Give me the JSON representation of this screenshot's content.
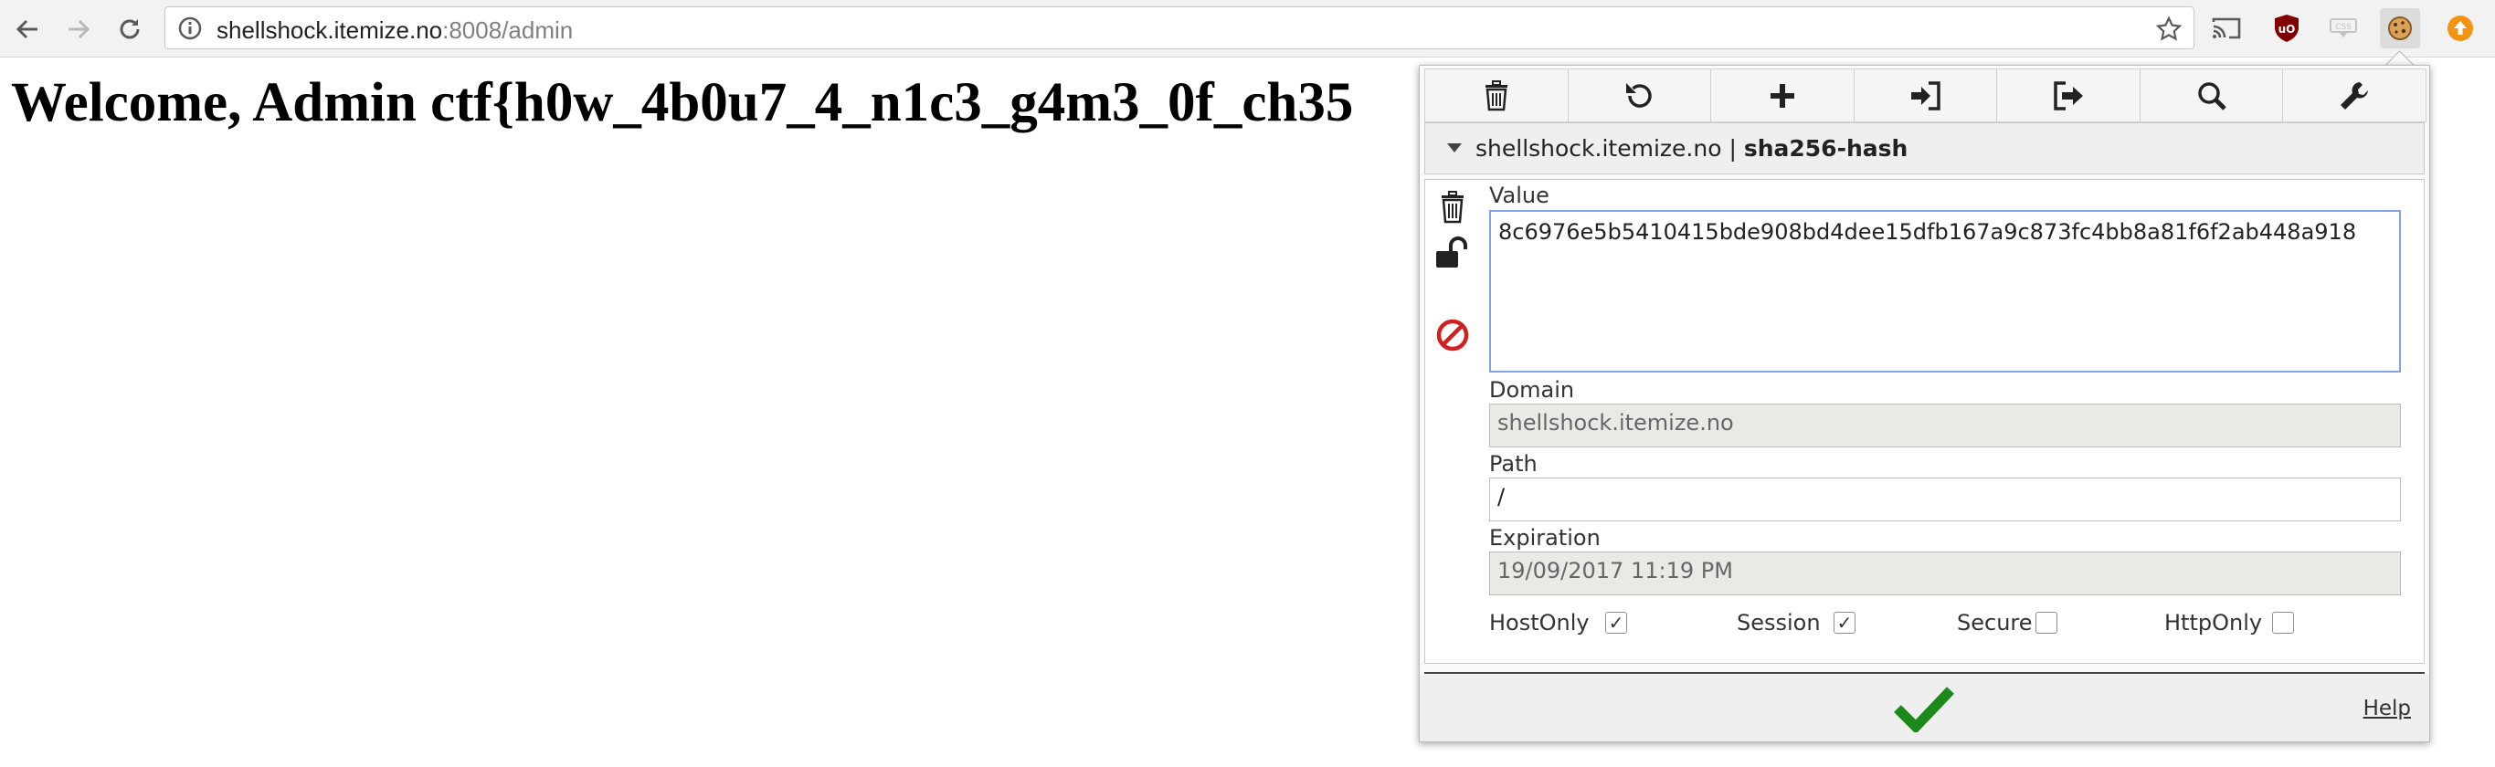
{
  "browser": {
    "url_host": "shellshock.itemize.no",
    "url_rest": ":8008/admin"
  },
  "page": {
    "heading": "Welcome, Admin ctf{h0w_4b0u7_4_n1c3_g4m3_0f_ch35"
  },
  "cookie_editor": {
    "header_domain": "shellshock.itemize.no",
    "header_separator": "|",
    "header_name": "sha256-hash",
    "value_label": "Value",
    "value": "8c6976e5b5410415bde908bd4dee15dfb167a9c873fc4bb8a81f6f2ab448a918",
    "domain_label": "Domain",
    "domain": "shellshock.itemize.no",
    "path_label": "Path",
    "path": "/",
    "expiration_label": "Expiration",
    "expiration": "19/09/2017 11:19 PM",
    "flags": [
      {
        "label": "HostOnly",
        "checked": true
      },
      {
        "label": "Session",
        "checked": true
      },
      {
        "label": "Secure",
        "checked": false
      },
      {
        "label": "HttpOnly",
        "checked": false
      }
    ],
    "help_label": "Help"
  },
  "colors": {
    "accept": "#1b8a1b",
    "block": "#d21f1f",
    "ublock": "#800000",
    "ext_orange": "#f29312"
  }
}
